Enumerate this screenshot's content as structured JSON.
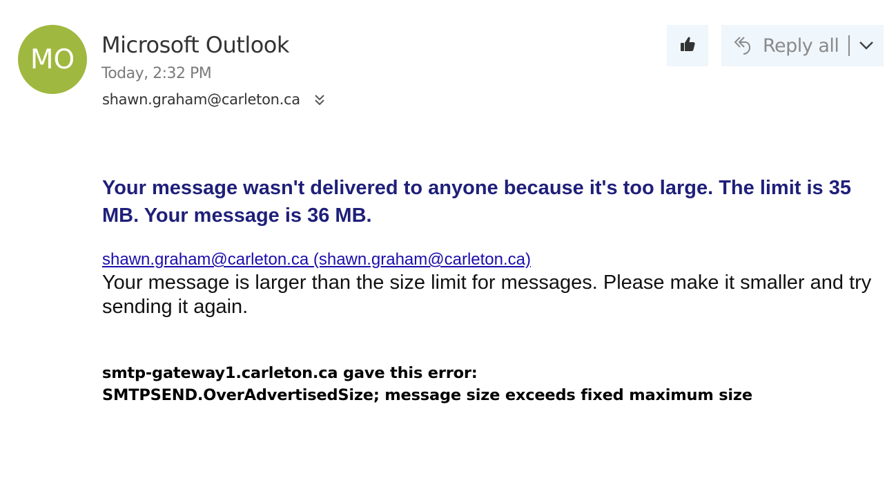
{
  "sender": {
    "initials": "MO",
    "avatar_color": "#9fb83f",
    "name": "Microsoft Outlook",
    "timestamp": "Today, 2:32 PM",
    "recipient": "shawn.graham@carleton.ca"
  },
  "toolbar": {
    "like_icon": "thumbs-up-icon",
    "reply_icon": "reply-all-icon",
    "reply_all_label": "Reply all",
    "dropdown_icon": "chevron-down-icon",
    "button_bg": "#eff6fc"
  },
  "message": {
    "headline": "Your message wasn't delivered to anyone because it's too large. The limit is 35 MB. Your message is 36 MB.",
    "recipient_link": "shawn.graham@carleton.ca (shawn.graham@carleton.ca)",
    "explanation": "Your message is larger than the size limit for messages. Please make it smaller and try sending it again.",
    "error_line1": "smtp-gateway1.carleton.ca gave this error:",
    "error_line2": "SMTPSEND.OverAdvertisedSize; message size exceeds fixed maximum size",
    "headline_color": "#1f1f7a",
    "link_color": "#1a0dab"
  }
}
